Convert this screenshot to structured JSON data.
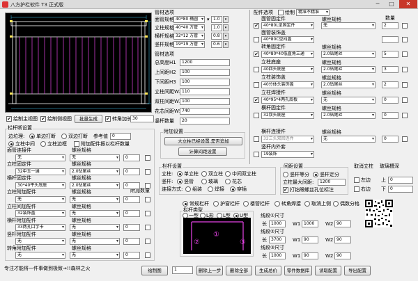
{
  "app": {
    "title": "八方护栏软件 T3 正式版",
    "minimize": "─",
    "maximize": "□",
    "close": "✕"
  },
  "pipe_options": {
    "title": "管材选项",
    "rows": [
      {
        "label": "面管规格",
        "value": "40*80 椭圆",
        "unit": "1.0"
      },
      {
        "label": "立柱规格",
        "value": "40*40 方管",
        "unit": "1.0"
      },
      {
        "label": "横杆规格",
        "value": "32*12 方管",
        "unit": "0.8"
      },
      {
        "label": "竖杆规格",
        "value": "19*19 方管",
        "unit": "0.6"
      }
    ]
  },
  "pipe_dims": {
    "title": "管材选项",
    "rows": [
      {
        "label": "总高度H1",
        "value": "1200"
      },
      {
        "label": "上间距H2",
        "value": "100"
      },
      {
        "label": "下间距H3",
        "value": "100"
      },
      {
        "label": "立柱间距W2",
        "value": "110"
      },
      {
        "label": "双柱间距W3",
        "value": "100"
      },
      {
        "label": "花芯间距W5",
        "value": "740"
      },
      {
        "label": "竖杆数量",
        "value": "20"
      }
    ]
  },
  "attach": {
    "title": "附加设置",
    "big_button": "大立柱已经设置,是否追加",
    "calc_button": "计算间距设置"
  },
  "parts": {
    "title": "配件选项",
    "plot_label": "绘制",
    "plot_value": "精准不精准",
    "qty_header": "数量",
    "spec_header": "螺丝规格",
    "groups": [
      {
        "title": "面管固定件",
        "name": "40*80L型固定件",
        "checked": true,
        "spec": "无",
        "qty": "2"
      },
      {
        "title": "面管装饰盖",
        "name": "40*80C型闷盖",
        "checked": false,
        "spec": "",
        "qty": ""
      },
      {
        "title": "转角固定件",
        "name": "40*80*40低直角三通",
        "checked": true,
        "spec": "2.0钻尾丝",
        "qty": "5"
      },
      {
        "title": "立柱底座",
        "name": "40四头底座",
        "checked": false,
        "spec": "2.0钻尾丝",
        "qty": "3"
      },
      {
        "title": "立柱装饰盖",
        "name": "40分体头装饰盖",
        "checked": false,
        "spec": "2.0钻尾丝",
        "qty": "2"
      },
      {
        "title": "立柱焊接件",
        "name": "40*95*4两孔底板",
        "checked": true,
        "spec": "无",
        "qty": "0"
      },
      {
        "title": "横杆固定件",
        "name": "32双头底座",
        "checked": false,
        "spec": "2.0钻尾丝",
        "qty": "0"
      },
      {
        "title": "横杆连接件",
        "name": "32三头双回连件",
        "checked": false,
        "spec": "无",
        "qty": "0"
      },
      {
        "title": "竖杆内外套",
        "name": "19装饰",
        "checked": false,
        "spec": "",
        "qty": ""
      }
    ]
  },
  "view_controls": {
    "show_main": "绘制主视图",
    "show_side": "绘制侧视图",
    "batch": "批量生成",
    "rotate": "转角加长",
    "rotate_value": "30"
  },
  "handrail": {
    "title": "栏杆断设置",
    "side_label": "边垃理:",
    "opt_single": "单边打断",
    "opt_double": "双边打断",
    "ref_label": "参考值",
    "ref_value": "0",
    "pos_label": "立柱位置",
    "opt_pos1": "立柱中间",
    "opt_pos2": "立柱边框",
    "extra_check": "附加配件振以栏杆数量",
    "spec_header": "螺丝规格",
    "add_qty": "附加数量",
    "rows": [
      {
        "title": "面管连接件",
        "name": "无",
        "spec": "无",
        "qty": "0"
      },
      {
        "title": "立柱固定件",
        "name": "32中五一通",
        "spec": "2.0钻尾丝",
        "qty": "0"
      },
      {
        "title": "横杆固定件",
        "name": "30*40平头底座",
        "spec": "2.0钻尾丝",
        "qty": "0"
      },
      {
        "title": "立柱附加配件",
        "name": "无",
        "spec": "无",
        "qty": "0"
      },
      {
        "title": "立柱间加配件",
        "name": "32装饰盖",
        "spec": "无",
        "qty": "0"
      },
      {
        "title": "横杆附加配件",
        "name": "33两孔口字卡",
        "spec": "无",
        "qty": "0"
      },
      {
        "title": "竖杆附加配件",
        "name": "无",
        "spec": "无",
        "qty": "0"
      },
      {
        "title": "转角附加配件",
        "name": "无",
        "spec": "无",
        "qty": "0"
      }
    ]
  },
  "rail_set": {
    "title": "栏杆设置",
    "col_label": "立柱:",
    "col_opts": [
      "单立柱",
      "双立柱",
      "中间双立柱"
    ],
    "vert_label": "竖杆:",
    "vert_opts": [
      "竖管",
      "玻璃",
      "花芯"
    ],
    "conn_label": "连接方式:",
    "conn_opts": [
      "组装",
      "焊接",
      "穿插"
    ]
  },
  "spacing": {
    "title": "间距设置",
    "opts": [
      "竖杆等分",
      "竖杆定分"
    ],
    "max_label": "立柱最大间距:",
    "max_value": "1200",
    "hole_label": "打钻眼螺丝孔位标注"
  },
  "corner": {
    "title": "取消立柱",
    "left": "左边",
    "right": "右边"
  },
  "glass": {
    "title": "玻璃槽深",
    "up": "上",
    "up_val": "0",
    "down": "下",
    "down_val": "0"
  },
  "rail_types": {
    "opts": [
      "常规栏杆",
      "护窗栏杆",
      "楼管栏杆",
      "转角焊接",
      "取消上侧",
      "偶数分格"
    ],
    "type_title": "栏杆类型",
    "shape_opts": [
      "一型",
      "L形",
      "L型",
      "U型"
    ],
    "segs": [
      {
        "title": "线段①尺寸",
        "l": "1000",
        "w": "1000",
        "w2": "90"
      },
      {
        "title": "线段②尺寸",
        "l": "3700",
        "w": "90",
        "w2": "90"
      },
      {
        "title": "线段③尺寸",
        "l": "1000",
        "w": "90",
        "w2": "90"
      }
    ]
  },
  "preview_labels": [
    "①",
    "②",
    "③"
  ],
  "bottom": {
    "status": "专注才能将一件事做到极致→!!森林之火",
    "draw": "绘制图",
    "page_value": "1",
    "btn_del": "删除上一步",
    "btn_clear": "删除全部",
    "btn_gen": "生成总价",
    "btn_db": "零件数据库",
    "btn_read": "读取配置",
    "btn_export": "导出配置"
  }
}
